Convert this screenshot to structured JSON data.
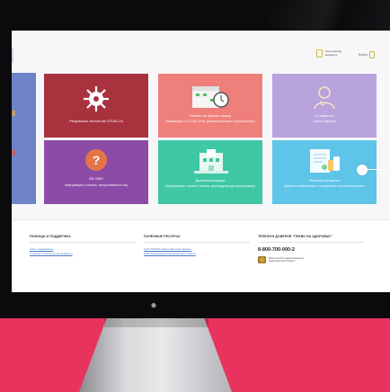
{
  "colors": {
    "background": "#e8335f",
    "tile_1": "#a8323e",
    "tile_2": "#ef7f7a",
    "tile_3": "#b9a3dc",
    "tile_4": "#8b4ba6",
    "tile_5": "#3fc7a6",
    "tile_6": "#5ec4e8",
    "sidebar": "#6f83c8"
  },
  "header": {
    "ehr_label": "Электронная медкарта",
    "logout_label": "Выйти"
  },
  "tiles": [
    {
      "title": "Результаты тестов на COVID-19",
      "subtitle": "",
      "icon": "virus-icon"
    },
    {
      "title": "Запись на прием к врачу",
      "subtitle": "Вакцинация от COVID-2019, диспансеризация и профосмотры",
      "icon": "calendar-clock-icon"
    },
    {
      "title": "О пациенте",
      "subtitle": "Личные данные",
      "icon": "doctor-icon"
    },
    {
      "title": "ОБ ОМС",
      "subtitle": "Информация о полисе, застрахованных лиц",
      "icon": "question-icon"
    },
    {
      "title": "Диспансеризация",
      "subtitle": "Информация о сроках и местах прохождения диспансеризации",
      "icon": "hospital-icon"
    },
    {
      "title": "Льготные рецепты",
      "subtitle": "Данные о выписанных и отпущенных льготных рецептах",
      "icon": "prescription-icon"
    }
  ],
  "footer": {
    "help": {
      "heading": "ПОМОЩЬ И ПОДДЕРЖКА",
      "links": [
        "Часто задаваемые",
        "О проекте Электронной медкарты"
      ]
    },
    "resources": {
      "heading": "ПОЛЕЗНЫЕ РЕСУРСЫ",
      "links": [
        "Сайт ТФОМС Новосибирской области",
        "Сайт Минздрава Новосибирской области"
      ]
    },
    "hotline": {
      "heading": "ТЕЛЕФОН ДОВЕРИЯ \"ПРАВО НА ЗДОРОВЬЕ\"",
      "phone": "8-800-700-000-2",
      "org": "Министерство здравоохранения Новосибирской области"
    }
  }
}
